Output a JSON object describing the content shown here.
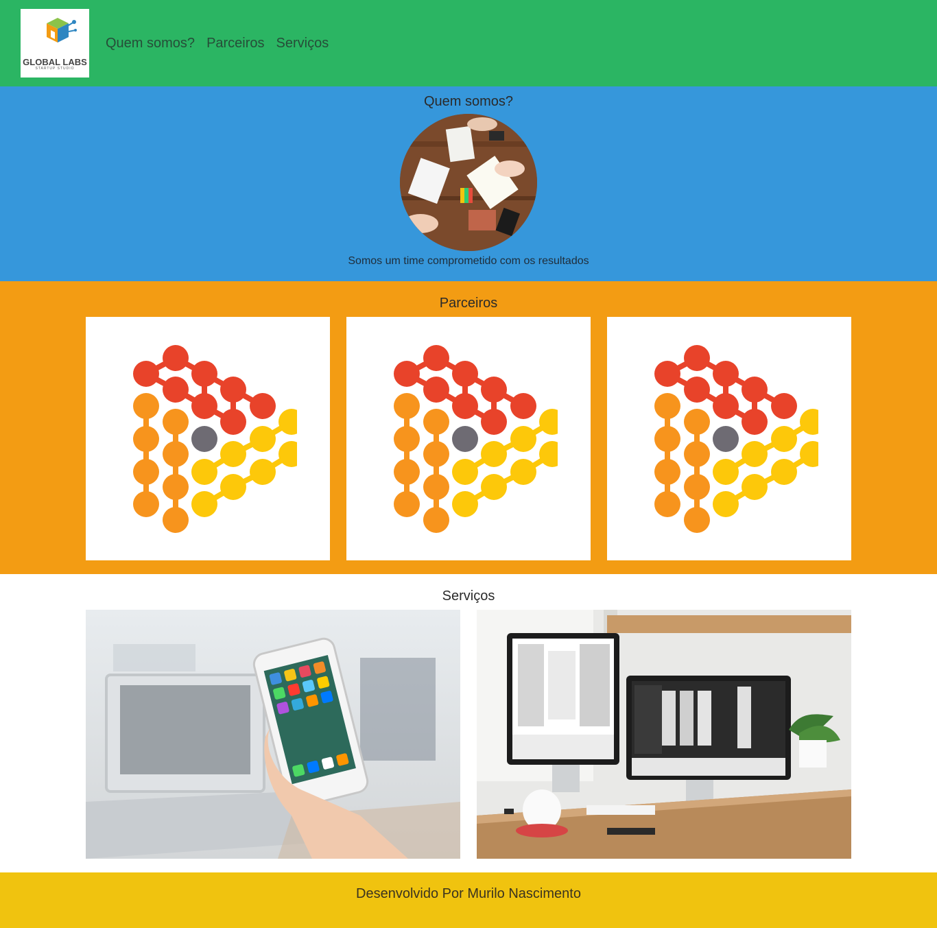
{
  "header": {
    "logo": {
      "title": "GLOBAL LABS",
      "subtitle": "STARTUP STUDIO",
      "icon": "cube-circuit-logo"
    },
    "nav": [
      {
        "label": "Quem somos?"
      },
      {
        "label": "Parceiros"
      },
      {
        "label": "Serviços"
      }
    ]
  },
  "about": {
    "title": "Quem somos?",
    "text": "Somos um time comprometido com os resultados"
  },
  "partners": {
    "title": "Parceiros",
    "items": [
      {
        "icon": "dot-triangle-logo"
      },
      {
        "icon": "dot-triangle-logo"
      },
      {
        "icon": "dot-triangle-logo"
      }
    ]
  },
  "services": {
    "title": "Serviços",
    "images": [
      {
        "icon": "smartphone-photo"
      },
      {
        "icon": "desktop-monitors-photo"
      }
    ]
  },
  "footer": {
    "text": "Desenvolvido Por Murilo Nascimento"
  },
  "colors": {
    "header": "#2bb563",
    "about": "#3697db",
    "partners": "#f39c13",
    "services": "#ffffff",
    "footer": "#f0c30f"
  }
}
